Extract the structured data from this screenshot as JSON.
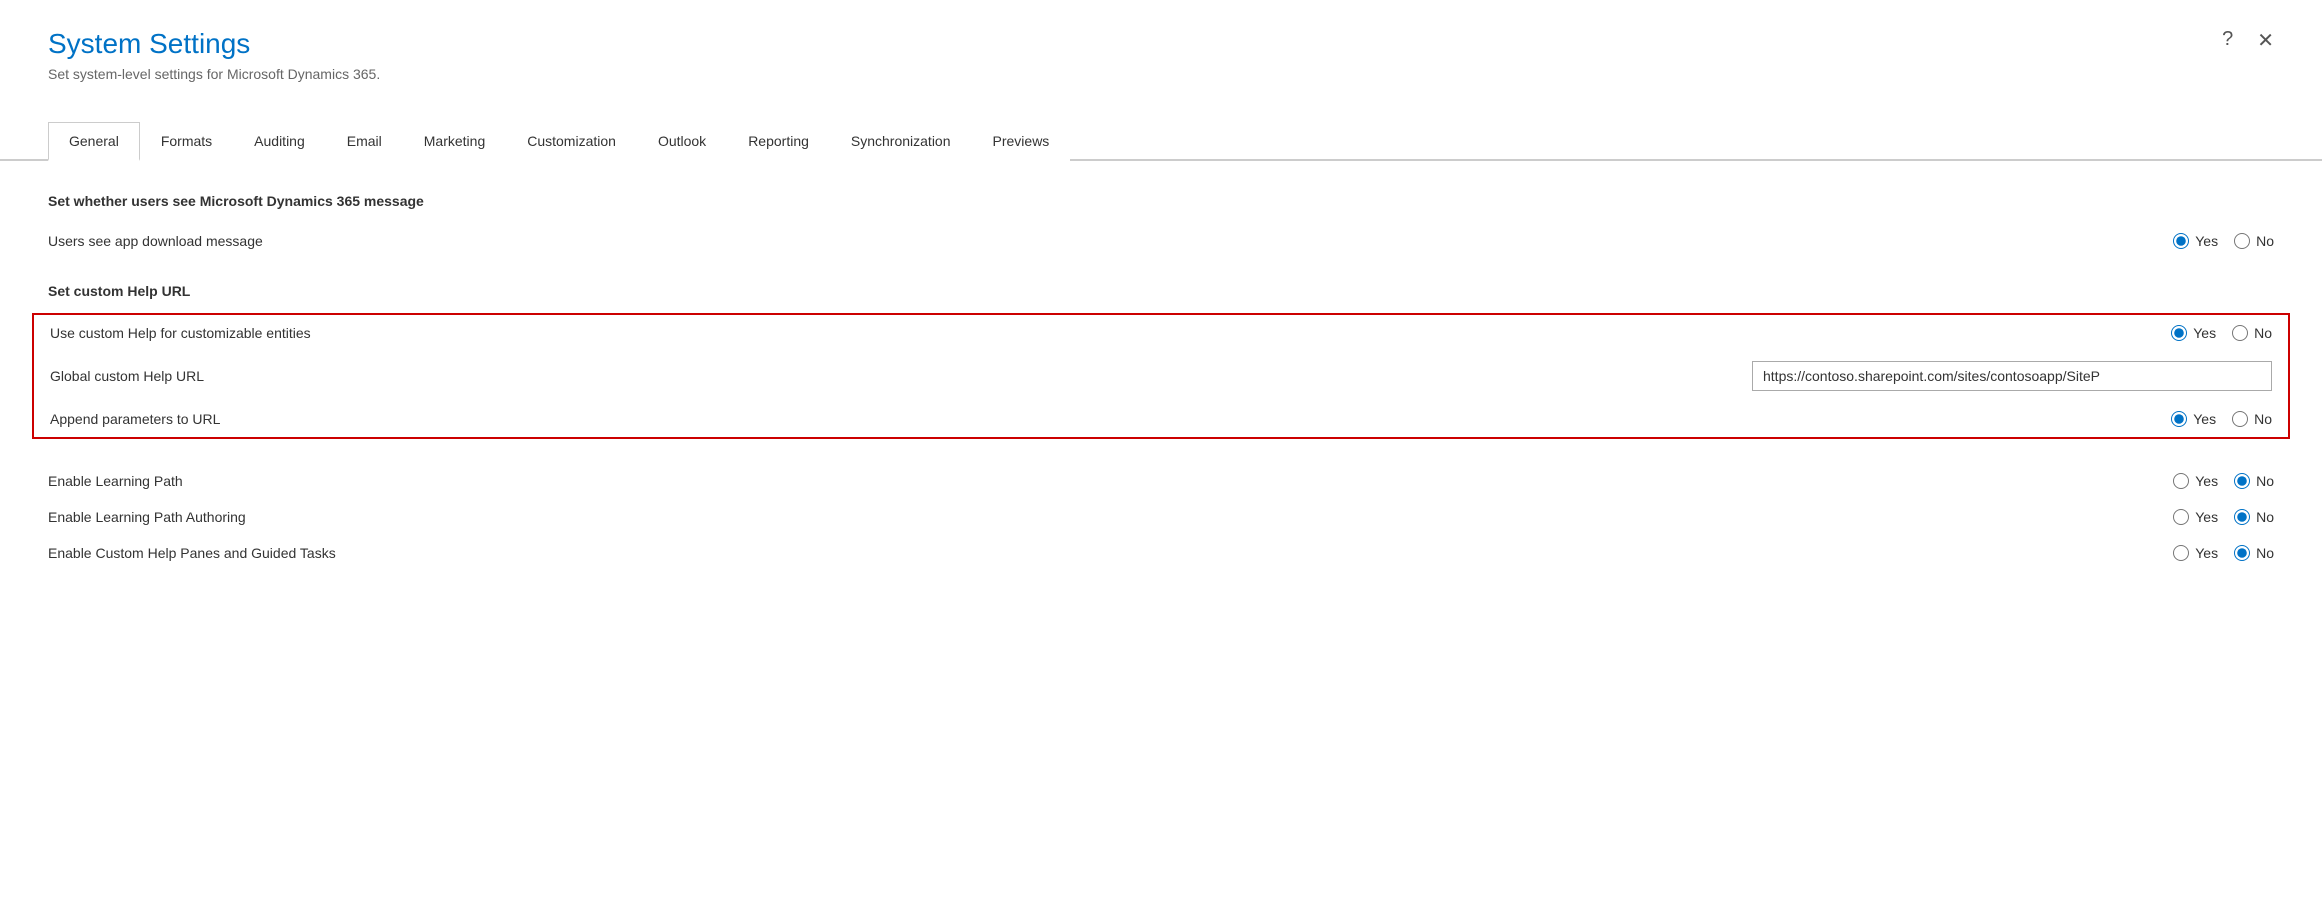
{
  "header": {
    "title": "System Settings",
    "subtitle": "Set system-level settings for Microsoft Dynamics 365.",
    "help_icon": "?",
    "close_icon": "✕"
  },
  "tabs": [
    {
      "id": "general",
      "label": "General",
      "active": true
    },
    {
      "id": "formats",
      "label": "Formats",
      "active": false
    },
    {
      "id": "auditing",
      "label": "Auditing",
      "active": false
    },
    {
      "id": "email",
      "label": "Email",
      "active": false
    },
    {
      "id": "marketing",
      "label": "Marketing",
      "active": false
    },
    {
      "id": "customization",
      "label": "Customization",
      "active": false
    },
    {
      "id": "outlook",
      "label": "Outlook",
      "active": false
    },
    {
      "id": "reporting",
      "label": "Reporting",
      "active": false
    },
    {
      "id": "synchronization",
      "label": "Synchronization",
      "active": false
    },
    {
      "id": "previews",
      "label": "Previews",
      "active": false
    }
  ],
  "sections": {
    "dynamics_message": {
      "title": "Set whether users see Microsoft Dynamics 365 message",
      "rows": [
        {
          "id": "app_download_message",
          "label": "Users see app download message",
          "yes_selected": true,
          "no_selected": false
        }
      ]
    },
    "custom_help_url": {
      "title": "Set custom Help URL",
      "highlighted": true,
      "rows": [
        {
          "id": "use_custom_help",
          "label": "Use custom Help for customizable entities",
          "type": "radio",
          "yes_selected": true,
          "no_selected": false
        },
        {
          "id": "global_custom_help_url",
          "label": "Global custom Help URL",
          "type": "input",
          "value": "https://contoso.sharepoint.com/sites/contosoapp/SiteP"
        },
        {
          "id": "append_parameters",
          "label": "Append parameters to URL",
          "type": "radio",
          "yes_selected": true,
          "no_selected": false
        }
      ]
    },
    "learning": {
      "rows": [
        {
          "id": "enable_learning_path",
          "label": "Enable Learning Path",
          "yes_selected": false,
          "no_selected": true
        },
        {
          "id": "enable_learning_path_authoring",
          "label": "Enable Learning Path Authoring",
          "yes_selected": false,
          "no_selected": true
        },
        {
          "id": "enable_custom_help_panes",
          "label": "Enable Custom Help Panes and Guided Tasks",
          "yes_selected": false,
          "no_selected": true
        }
      ]
    }
  },
  "labels": {
    "yes": "Yes",
    "no": "No"
  }
}
